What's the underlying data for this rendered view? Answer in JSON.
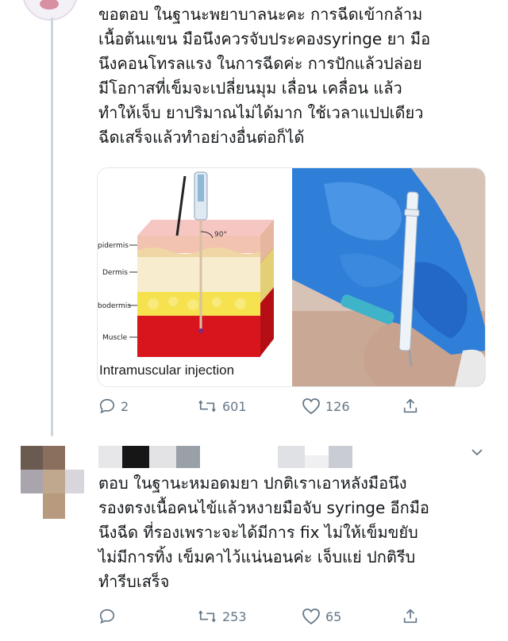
{
  "tweet1": {
    "text": "ขอตอบ ในฐานะพยาบาลนะคะ การฉีดเข้ากล้าม\nเนื้อต้นแขน มือนึงควรจับประคองsyringe ยา มือ\nนึงคอนโทรลแรง ในการฉีดค่ะ การปักแล้วปล่อย\nมีโอกาสที่เข็มจะเปลี่ยนมุม เลื่อน เคลื่อน แล้ว\nทำให้เจ็บ ยาปริมาณไม่ได้มาก ใช้เวลาแปปเดียว\nฉีดเสร็จแล้วทำอย่างอื่นต่อก็ได้",
    "diagram": {
      "angle": "90°",
      "layers": [
        "pidermis",
        "Dermis",
        "bodermis",
        "Muscle"
      ],
      "caption": "Intramuscular injection"
    },
    "actions": {
      "replies": "2",
      "retweets": "601",
      "likes": "126"
    }
  },
  "tweet2": {
    "text": "ตอบ ในฐานะหมอดมยา ปกติเราเอาหลังมือนึง\nรองตรงเนื้อคนไข้แล้วหงายมือจับ syringe อีกมือ\nนึงฉีด ที่รองเพราะจะได้มีการ fix ไม่ให้เข็มขยับ\nไม่มีการทิ้ง เข็มคาไว้แน่นอนค่ะ เจ็บแย่ ปกติรีบ\nทำรีบเสร็จ",
    "actions": {
      "replies": "",
      "retweets": "253",
      "likes": "65"
    }
  },
  "icons": {
    "reply": "reply-icon",
    "retweet": "retweet-icon",
    "like": "heart-icon",
    "share": "share-icon",
    "more": "chevron-down-icon"
  },
  "colors": {
    "icon_gray": "#657786",
    "text": "#14171a",
    "thread_line": "#ccd6dd",
    "glove_blue": "#2f7fd8",
    "muscle_red": "#d8141c"
  }
}
